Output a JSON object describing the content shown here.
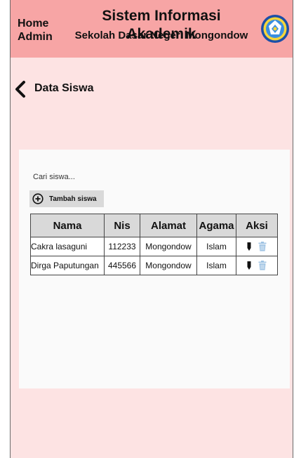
{
  "header": {
    "home_label": "Home",
    "admin_label": "Admin",
    "app_title": "Sistem Informasi Akademik",
    "school_name": "Sekolah Dasar Negeri Mongondow",
    "logo_icon": "tut-wuri-handayani-logo-icon"
  },
  "page": {
    "back_icon": "chevron-left-icon",
    "title": "Data Siswa"
  },
  "search": {
    "placeholder": "Cari siswa..."
  },
  "add_button": {
    "icon": "plus-circle-icon",
    "label": "Tambah siswa"
  },
  "table": {
    "headers": [
      "Nama",
      "Nis",
      "Alamat",
      "Agama",
      "Aksi"
    ],
    "rows": [
      {
        "nama": "Cakra lasaguni",
        "nis": "112233",
        "alamat": "Mongondow",
        "agama": "Islam"
      },
      {
        "nama": "Dirga Paputungan",
        "nis": "445566",
        "alamat": "Mongondow",
        "agama": "Islam"
      }
    ],
    "action_icons": [
      "edit-pen-icon",
      "trash-icon"
    ]
  },
  "colors": {
    "header_bg": "#f7a5a5",
    "page_bg": "#fde3e3",
    "card_bg": "#fafafa",
    "table_header_bg": "#d9d9d9",
    "trash_icon": "#9fc3e3"
  }
}
